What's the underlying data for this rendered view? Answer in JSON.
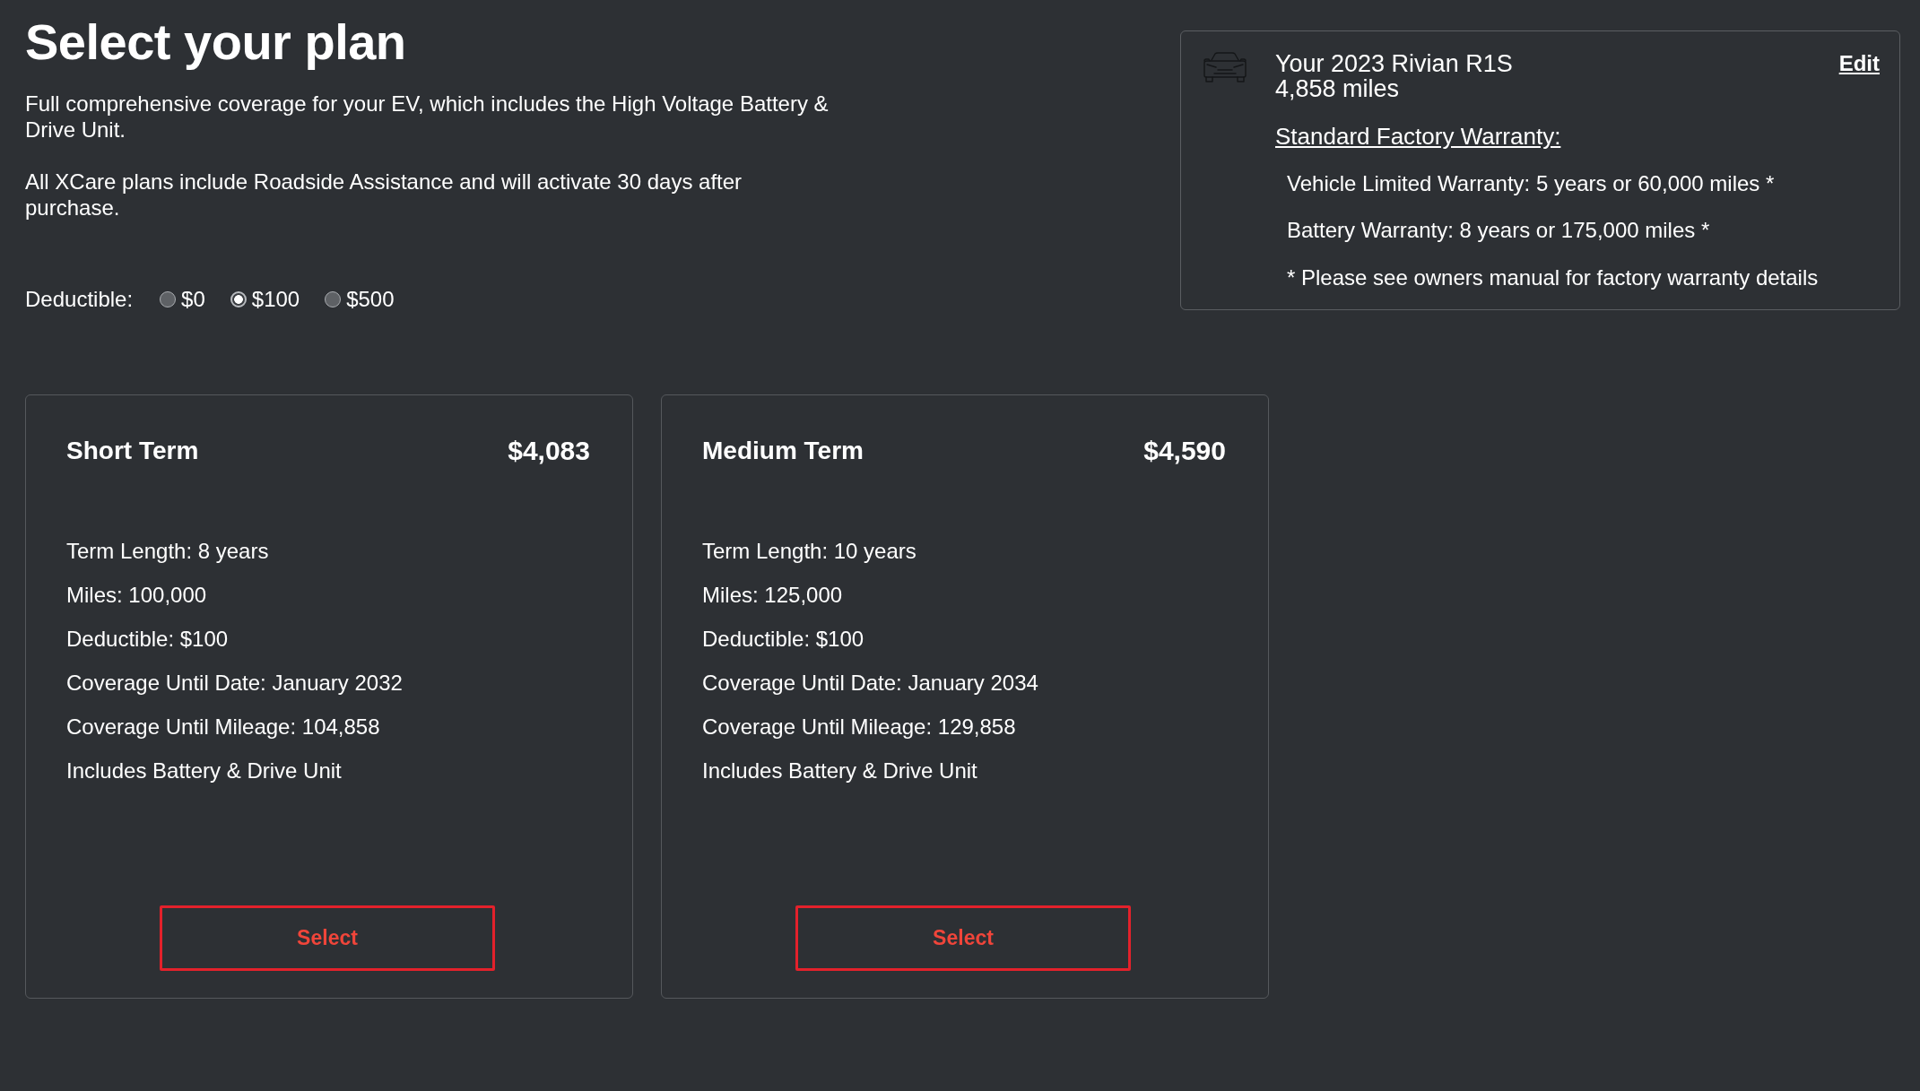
{
  "header": {
    "title": "Select your plan",
    "paragraphs": [
      "Full comprehensive coverage for your EV, which includes the High Voltage Battery & Drive Unit.",
      "All XCare plans include Roadside Assistance and will activate 30 days after purchase."
    ]
  },
  "deductible": {
    "label": "Deductible:",
    "options": [
      {
        "label": "$0",
        "selected": false
      },
      {
        "label": "$100",
        "selected": true
      },
      {
        "label": "$500",
        "selected": false
      }
    ]
  },
  "vehicle": {
    "title": "Your 2023 Rivian R1S",
    "mileage": "4,858 miles",
    "edit": "Edit",
    "warranty_heading": "Standard Factory Warranty:",
    "warranty_items": [
      "Vehicle Limited Warranty: 5 years or 60,000 miles *",
      "Battery Warranty: 8 years or 175,000 miles *",
      "* Please see owners manual for factory warranty details"
    ]
  },
  "plans": [
    {
      "name": "Short Term",
      "price": "$4,083",
      "details": [
        "Term Length: 8 years",
        "Miles: 100,000",
        "Deductible: $100",
        "Coverage Until Date: January 2032",
        "Coverage Until Mileage: 104,858",
        "Includes Battery & Drive Unit"
      ],
      "button": "Select"
    },
    {
      "name": "Medium Term",
      "price": "$4,590",
      "details": [
        "Term Length: 10 years",
        "Miles: 125,000",
        "Deductible: $100",
        "Coverage Until Date: January 2034",
        "Coverage Until Mileage: 129,858",
        "Includes Battery & Drive Unit"
      ],
      "button": "Select"
    }
  ]
}
